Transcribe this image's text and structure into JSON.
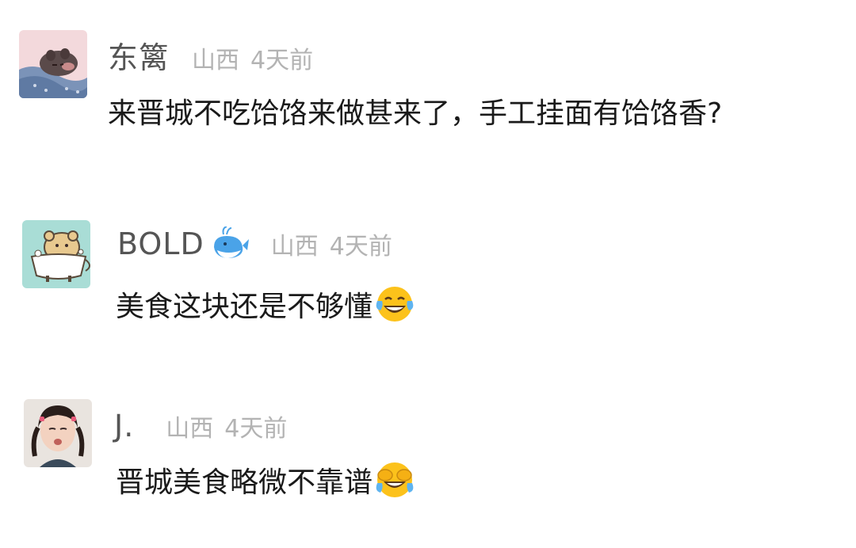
{
  "comments": [
    {
      "username": "东篱",
      "location": "山西",
      "time": "4天前",
      "text": "来晋城不吃饸饹来做甚来了，手工挂面有饸饹香?",
      "avatar_icon": "pig-sleeping-avatar",
      "emoji": null
    },
    {
      "username": "BOLD",
      "location": "山西",
      "time": "4天前",
      "text": "美食这块还是不够懂",
      "avatar_icon": "cat-in-bathtub-avatar",
      "badge_icon": "blue-whale-badge-icon",
      "emoji": "tears-of-joy-emoji"
    },
    {
      "username": "J.",
      "location": "山西",
      "time": "4天前",
      "text": "晋城美食略微不靠谱",
      "avatar_icon": "girl-photo-avatar",
      "emoji": "covering-face-laughing-emoji"
    }
  ],
  "colors": {
    "username": "#555555",
    "meta": "#b3b3b3",
    "text": "#1a1a1a",
    "background": "#ffffff"
  }
}
